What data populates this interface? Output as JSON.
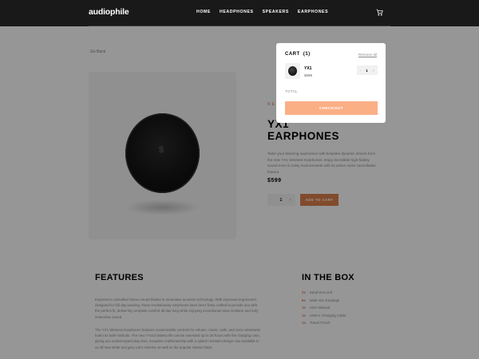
{
  "header": {
    "logo": "audiophile",
    "nav": [
      "HOME",
      "HEADPHONES",
      "SPEAKERS",
      "EARPHONES"
    ]
  },
  "page": {
    "go_back": "Go Back",
    "overline": "NEW PRODUCT",
    "title": "YX1 EARPHONES",
    "description": "Tailor your listening experience with bespoke dynamic drivers from the new YX1 Wireless Earphones. Enjoy incredible high-fidelity sound even in noisy environments with its active noise cancellation feature.",
    "price": "$599",
    "quantity": "1",
    "minus": "-",
    "plus": "+",
    "add_to_cart": "ADD TO CART",
    "features_title": "FEATURES",
    "features_p1": "Experience unrivalled stereo sound thanks to innovative acoustic technology. With improved ergonomics designed for full day wearing, these revolutionary earphones have been finely crafted to provide you with the perfect fit, delivering complete comfort all day long while enjoying exceptional noise isolation and truly immersive sound.",
    "features_p2": "The YX1 Wireless Earphones features customizable controls for volume, music, calls, and voice assistants built into both earbuds. The new 7-hour battery life can be extended up to 28 hours with the charging case, giving you uninterrupted play time. Exquisite craftsmanship with a splash resistant design now available in an all new white and grey color scheme as well as the popular classic black.",
    "box_title": "IN THE BOX",
    "box_items": [
      {
        "qty": "2x",
        "name": "Earphone Unit"
      },
      {
        "qty": "6x",
        "name": "Multi-size Earplugs"
      },
      {
        "qty": "1x",
        "name": "User Manual"
      },
      {
        "qty": "1x",
        "name": "USB-C Charging Cable"
      },
      {
        "qty": "1x",
        "name": "Travel Pouch"
      }
    ]
  },
  "cart": {
    "title": "CART",
    "count": "(1)",
    "remove_all": "Remove all",
    "item_name": "YX1",
    "item_price": "$599",
    "item_qty": "1",
    "minus": "-",
    "plus": "+",
    "total_label": "TOTAL",
    "checkout": "CHECKOUT"
  },
  "colors": {
    "accent": "#d87d4a",
    "accent_light": "#fbaf85",
    "header_bg": "#191919"
  },
  "icons": {
    "cart": "cart-icon",
    "earphone": "earphone-image"
  }
}
